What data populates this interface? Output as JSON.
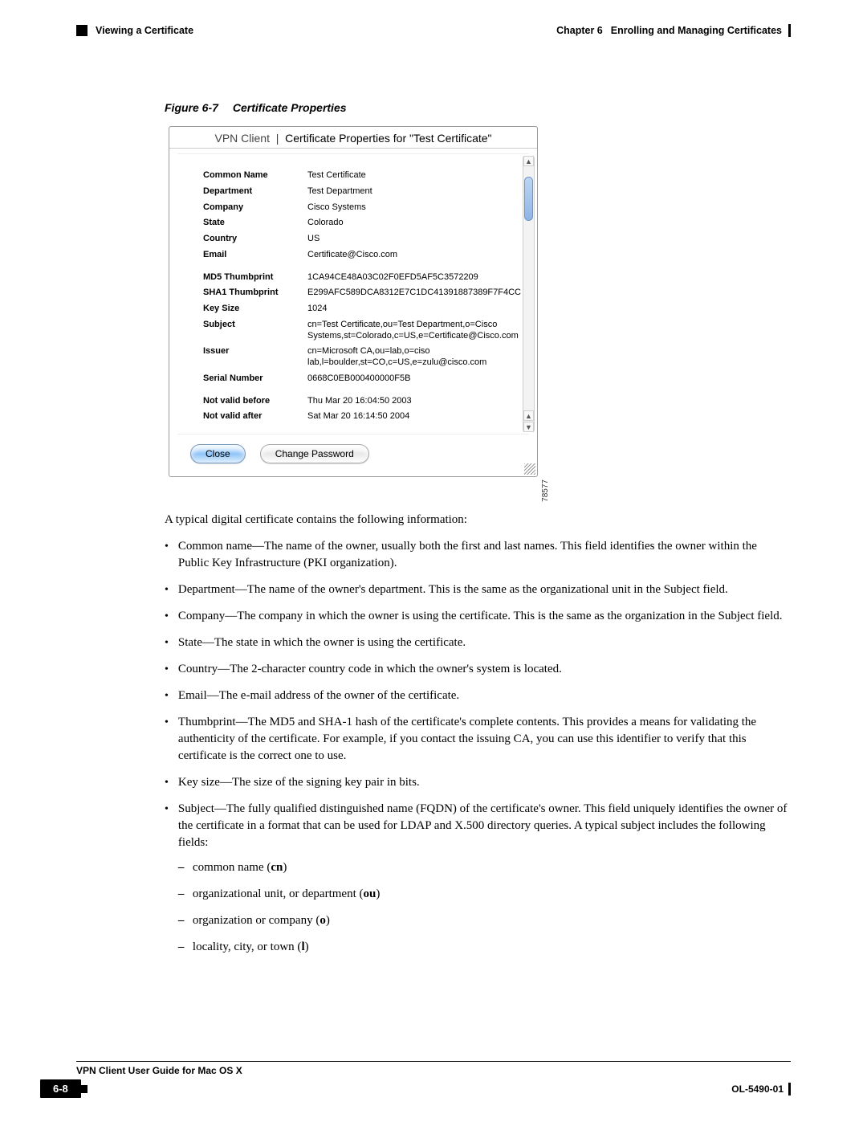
{
  "header": {
    "section": "Viewing a Certificate",
    "chapter": "Chapter 6",
    "chapter_title": "Enrolling and Managing Certificates"
  },
  "figure": {
    "caption_num": "Figure 6-7",
    "caption_text": "Certificate Properties",
    "app_label": "VPN Client",
    "window_title": "Certificate Properties for \"Test Certificate\"",
    "image_id": "78577",
    "fields": [
      {
        "label": "Common Name",
        "value": "Test Certificate"
      },
      {
        "label": "Department",
        "value": "Test Department"
      },
      {
        "label": "Company",
        "value": "Cisco Systems"
      },
      {
        "label": "State",
        "value": "Colorado"
      },
      {
        "label": "Country",
        "value": "US"
      },
      {
        "label": "Email",
        "value": "Certificate@Cisco.com"
      }
    ],
    "fields2": [
      {
        "label": "MD5 Thumbprint",
        "value": "1CA94CE48A03C02F0EFD5AF5C3572209"
      },
      {
        "label": "SHA1 Thumbprint",
        "value": "E299AFC589DCA8312E7C1DC41391887389F7F4CC"
      },
      {
        "label": "Key Size",
        "value": "1024"
      },
      {
        "label": "Subject",
        "value": "cn=Test Certificate,ou=Test Department,o=Cisco Systems,st=Colorado,c=US,e=Certificate@Cisco.com"
      },
      {
        "label": "Issuer",
        "value": "cn=Microsoft CA,ou=lab,o=ciso lab,l=boulder,st=CO,c=US,e=zulu@cisco.com"
      },
      {
        "label": "Serial Number",
        "value": "0668C0EB000400000F5B"
      }
    ],
    "fields3": [
      {
        "label": "Not valid before",
        "value": "Thu Mar 20 16:04:50 2003"
      },
      {
        "label": "Not valid after",
        "value": "Sat Mar 20 16:14:50 2004"
      }
    ],
    "buttons": {
      "close": "Close",
      "change_pw": "Change Password"
    }
  },
  "body": {
    "intro": "A typical digital certificate contains the following information:",
    "bullets": [
      "Common name—The name of the owner, usually both the first and last names. This field identifies the owner within the Public Key Infrastructure (PKI organization).",
      "Department—The name of the owner's department. This is the same as the organizational unit in the Subject field.",
      "Company—The company in which the owner is using the certificate. This is the same as the organization in the Subject field.",
      "State—The state in which the owner is using the certificate.",
      "Country—The 2-character country code in which the owner's system is located.",
      "Email—The e-mail address of the owner of the certificate.",
      "Thumbprint—The MD5 and SHA-1 hash of the certificate's complete contents. This provides a means for validating the authenticity of the certificate. For example, if you contact the issuing CA, you can use this identifier to verify that this certificate is the correct one to use.",
      "Key size—The size of the signing key pair in bits."
    ],
    "bullet_subject_lead": "Subject—The fully qualified distinguished name (FQDN) of the certificate's owner. This field uniquely identifies the owner of the certificate in a format that can be used for LDAP and X.500 directory queries. A typical subject includes the following fields:",
    "sub": [
      {
        "pre": "common name (",
        "bold": "cn",
        "post": ")"
      },
      {
        "pre": "organizational unit, or department (",
        "bold": "ou",
        "post": ")"
      },
      {
        "pre": "organization or company (",
        "bold": "o",
        "post": ")"
      },
      {
        "pre": "locality, city, or town (",
        "bold": "l",
        "post": ")"
      }
    ]
  },
  "footer": {
    "doc_title": "VPN Client User Guide for Mac OS X",
    "page_num": "6-8",
    "doc_id": "OL-5490-01"
  }
}
